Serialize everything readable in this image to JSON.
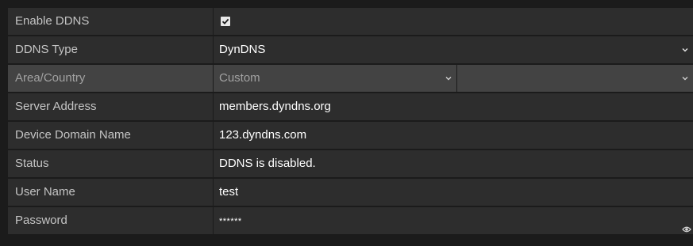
{
  "form": {
    "enable_ddns": {
      "label": "Enable DDNS",
      "checked": true
    },
    "ddns_type": {
      "label": "DDNS Type",
      "value": "DynDNS"
    },
    "area_country": {
      "label": "Area/Country",
      "value": "Custom",
      "secondary_value": ""
    },
    "server_address": {
      "label": "Server Address",
      "value": "members.dyndns.org"
    },
    "device_domain_name": {
      "label": "Device Domain Name",
      "value": "123.dyndns.com"
    },
    "status": {
      "label": "Status",
      "value": "DDNS is disabled."
    },
    "user_name": {
      "label": "User Name",
      "value": "test"
    },
    "password": {
      "label": "Password",
      "value": "******"
    }
  },
  "icons": {
    "checkbox": "check-icon",
    "dropdown": "chevron-down-icon",
    "password_toggle": "eye-icon"
  }
}
